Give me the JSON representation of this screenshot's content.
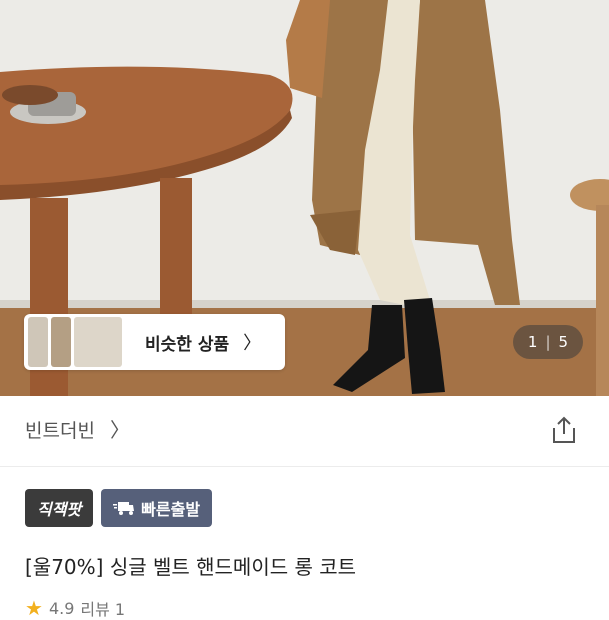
{
  "hero": {
    "image_alt": "",
    "similar_products": {
      "label": "비슷한 상품",
      "chevron": "chevron-right-icon"
    },
    "counter": {
      "current": "1",
      "separator": "|",
      "total": "5"
    }
  },
  "shop": {
    "name": "빈트더빈",
    "chevron": "chevron-right-icon",
    "share_icon": "share-icon"
  },
  "badges": [
    {
      "label": "직잭팟"
    },
    {
      "label": "빠른출발",
      "icon": "truck-icon"
    }
  ],
  "product": {
    "title": "[울70%] 싱글 벨트 핸드메이드 롱 코트"
  },
  "rating": {
    "score": "4.9",
    "reviews": "리뷰 1"
  },
  "colors": {
    "badge_dark": "#3b3b3b",
    "badge_blue": "#56607a",
    "star": "#f2b01e"
  }
}
